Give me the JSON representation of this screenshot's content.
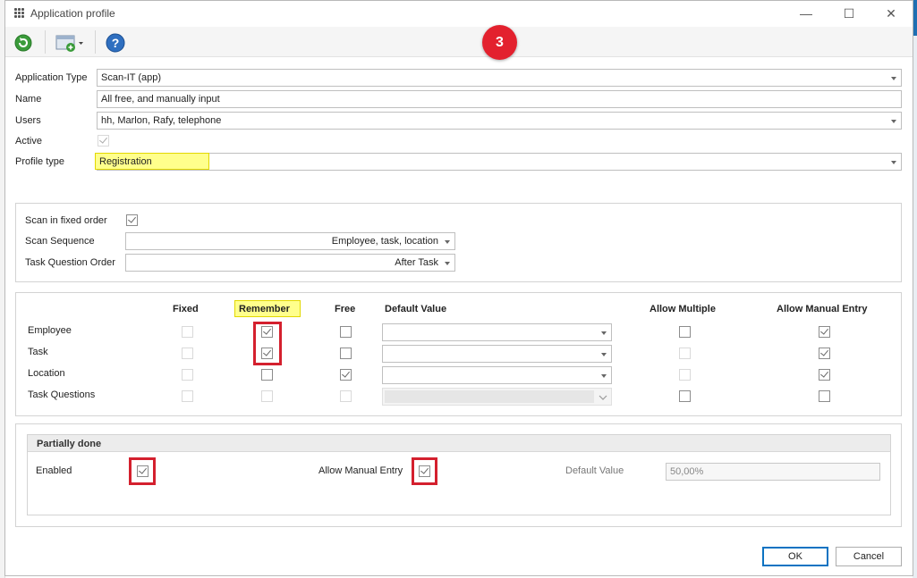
{
  "window": {
    "title": "Application profile",
    "minimize_glyph": "—",
    "maximize_glyph": "☐",
    "close_glyph": "✕"
  },
  "toolbar": {
    "icons": [
      "refresh-icon",
      "window-add-icon",
      "help-icon"
    ],
    "help_glyph": "?"
  },
  "annotation_badge": "3",
  "form": {
    "application_type_label": "Application Type",
    "application_type_value": "Scan-IT (app)",
    "name_label": "Name",
    "name_value": "All free, and manually input",
    "users_label": "Users",
    "users_value": "hh, Marlon, Rafy, telephone",
    "active_label": "Active",
    "active_checked": true,
    "profile_type_label": "Profile type",
    "profile_type_value": "Registration"
  },
  "scan": {
    "fixed_order_label": "Scan in fixed order",
    "fixed_order_checked": true,
    "sequence_label": "Scan Sequence",
    "sequence_value": "Employee, task, location",
    "task_question_order_label": "Task Question Order",
    "task_question_order_value": "After Task"
  },
  "grid": {
    "headers": {
      "fixed": "Fixed",
      "remember": "Remember",
      "free": "Free",
      "default_value": "Default Value",
      "allow_multiple": "Allow Multiple",
      "allow_manual_entry": "Allow Manual Entry"
    },
    "rows": [
      {
        "label": "Employee",
        "fixed": false,
        "remember": true,
        "free": false,
        "allow_multiple": false,
        "allow_manual_entry": true
      },
      {
        "label": "Task",
        "fixed": false,
        "remember": true,
        "free": false,
        "allow_multiple": false,
        "allow_manual_entry": true
      },
      {
        "label": "Location",
        "fixed": false,
        "remember": false,
        "free": true,
        "allow_multiple": false,
        "allow_manual_entry": true
      },
      {
        "label": "Task Questions",
        "fixed": false,
        "remember": false,
        "free": false,
        "allow_multiple": false,
        "allow_manual_entry": false
      }
    ]
  },
  "partially_done": {
    "title": "Partially done",
    "enabled_label": "Enabled",
    "enabled_checked": true,
    "allow_manual_entry_label": "Allow Manual Entry",
    "allow_manual_entry_checked": true,
    "default_value_label": "Default Value",
    "default_value": "50,00%"
  },
  "footer": {
    "ok_label": "OK",
    "cancel_label": "Cancel"
  },
  "colors": {
    "badge": "#e3212e",
    "highlight": "#ffff8c",
    "red_outline": "#d4202e",
    "ok_border": "#0c73c2"
  }
}
